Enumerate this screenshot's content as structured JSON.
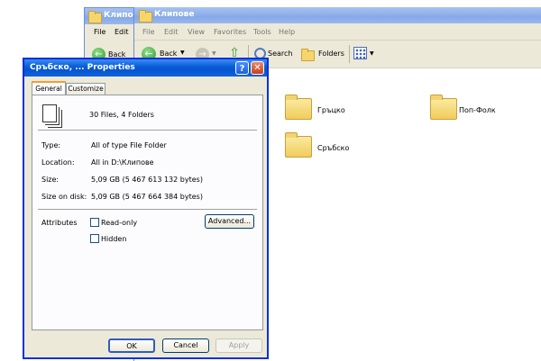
{
  "back_window": {
    "title": "Клипове",
    "menu": [
      "File",
      "Edit"
    ],
    "toolbar_back": "Back"
  },
  "main_window": {
    "title": "Клипове",
    "menu": [
      "File",
      "Edit",
      "View",
      "Favorites",
      "Tools",
      "Help"
    ],
    "toolbar": {
      "back": "Back",
      "search": "Search",
      "folders": "Folders"
    },
    "folders": [
      {
        "name": "Гръцко"
      },
      {
        "name": "Поп-Фолк"
      },
      {
        "name": "Сръбско"
      }
    ]
  },
  "dialog": {
    "title": "Сръбско, ... Properties",
    "tabs": [
      "General",
      "Customize"
    ],
    "summary": "30 Files, 4 Folders",
    "rows": [
      {
        "label": "Type:",
        "value": "All of type File Folder"
      },
      {
        "label": "Location:",
        "value": "All in D:\\Клипове"
      },
      {
        "label": "Size:",
        "value": "5,09 GB (5 467 613 132 bytes)"
      },
      {
        "label": "Size on disk:",
        "value": "5,09 GB (5 467 664 384 bytes)"
      }
    ],
    "attributes_label": "Attributes",
    "readonly": "Read-only",
    "hidden": "Hidden",
    "advanced": "Advanced...",
    "ok": "OK",
    "cancel": "Cancel",
    "apply": "Apply"
  }
}
